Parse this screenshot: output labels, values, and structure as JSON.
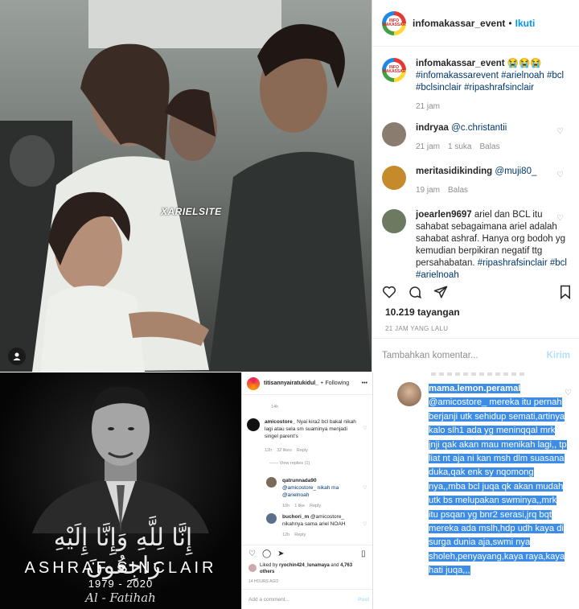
{
  "post": {
    "username": "infomakassar_event",
    "follow_label": "Ikuti",
    "separator": "•",
    "watermark": "XARIELSITE",
    "caption": {
      "username": "infomakassar_event",
      "text": "😭😭😭 #infomakassarevent #arielnoah #bcl #bclsinclair #ripashrafsinclair",
      "time": "21 jam"
    },
    "comments": [
      {
        "username": "indryaa",
        "text": "@c.christantii",
        "time": "21 jam",
        "likes": "1 suka",
        "reply": "Balas"
      },
      {
        "username": "meritasidikinding",
        "text": "@muji80_",
        "time": "19 jam",
        "reply": "Balas"
      },
      {
        "username": "joearlen9697",
        "text": "ariel dan BCL itu sahabat sebagaimana ariel adalah sahabat ashraf. Hanya org bodoh yg kemudian berpikiran negatif ttg persahabatan.",
        "tags": "#ripashrafsinclair #bcl #arielnoah"
      }
    ],
    "views": "10.219 tayangan",
    "posted_ago": "21 JAM YANG LALU",
    "add_comment_placeholder": "Tambahkan komentar...",
    "send_label": "Kirim"
  },
  "memorial": {
    "arabic": "إِنَّا لِلَّهِ وَإِنَّا إِلَيْهِ رَاجِعُونَ",
    "name": "ASHRAF SINCLAIR",
    "years": "1979 - 2020",
    "fatihah": "Al - Fatihah"
  },
  "small_post": {
    "username": "titisannyairatukidul_",
    "separator": "•",
    "follow_label": "Following",
    "time_top": "14h",
    "comments": [
      {
        "username": "amicostore_",
        "text": "Nyai kira2 bcl bakal nikah lagi atau sela sm suaminya menjadi singel parent's",
        "time": "12h",
        "likes": "32 likes",
        "reply": "Reply"
      },
      {
        "view_replies": "View replies (1)"
      },
      {
        "username": "qatrunnada90",
        "text": "@amicostore_ nikah ma @arielnoah",
        "time": "10h",
        "likes": "1 like",
        "reply": "Reply"
      },
      {
        "username": "buchori_m",
        "text": "@amicostore_ nikahnya sama ariel NOAH",
        "time": "12h",
        "reply": "Reply"
      }
    ],
    "liked_by_prefix": "Liked by",
    "liked_by_user": "ryochin424_lunamaya",
    "liked_by_and": "and",
    "liked_by_others": "4,763 others",
    "posted_ago": "14 HOURS AGO",
    "add_comment": "Add a comment...",
    "post_label": "Post"
  },
  "big_comment": {
    "username": "mama.lemon.peramal",
    "text": "@amicostore_ mereka itu pernah berjanji utk sehidup semati,artinya kalo slh1 ada yg meninqqal mrk jnji qak akan mau menikah lagi,, tp liat nt aja ni kan msh dlm suasana duka,qak enk sy nqomong nya,,mba bcl juqa qk akan mudah utk bs melupakan swminya,,mrk itu psqan yg bnr2 serasi,jrq bqt mereka ada mslh,hdp udh kaya di surga dunia aja,swmi nya sholeh,penyayang,kaya raya,kaya hati juqa,,,"
  },
  "colors": {
    "accent": "#0095f6",
    "highlight": "#3d8ce6",
    "muted": "#8e8e8e"
  }
}
